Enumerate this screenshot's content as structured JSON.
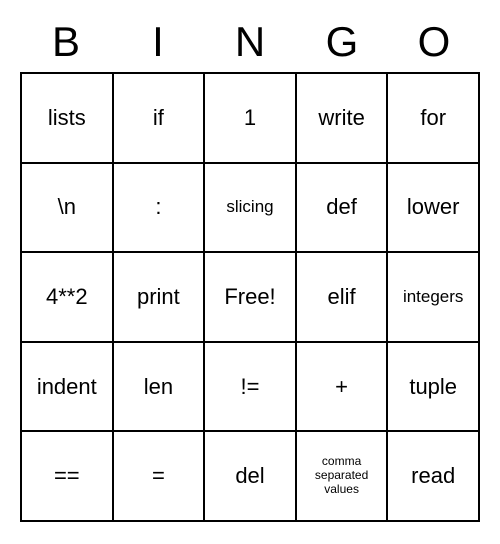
{
  "header": [
    "B",
    "I",
    "N",
    "G",
    "O"
  ],
  "cells": [
    {
      "text": "lists",
      "size": "normal"
    },
    {
      "text": "if",
      "size": "normal"
    },
    {
      "text": "1",
      "size": "normal"
    },
    {
      "text": "write",
      "size": "normal"
    },
    {
      "text": "for",
      "size": "normal"
    },
    {
      "text": "\\n",
      "size": "normal"
    },
    {
      "text": ":",
      "size": "normal"
    },
    {
      "text": "slicing",
      "size": "small"
    },
    {
      "text": "def",
      "size": "normal"
    },
    {
      "text": "lower",
      "size": "normal"
    },
    {
      "text": "4**2",
      "size": "normal"
    },
    {
      "text": "print",
      "size": "normal"
    },
    {
      "text": "Free!",
      "size": "normal"
    },
    {
      "text": "elif",
      "size": "normal"
    },
    {
      "text": "integers",
      "size": "small"
    },
    {
      "text": "indent",
      "size": "normal"
    },
    {
      "text": "len",
      "size": "normal"
    },
    {
      "text": "!=",
      "size": "normal"
    },
    {
      "text": "+",
      "size": "normal"
    },
    {
      "text": "tuple",
      "size": "normal"
    },
    {
      "text": "==",
      "size": "normal"
    },
    {
      "text": "=",
      "size": "normal"
    },
    {
      "text": "del",
      "size": "normal"
    },
    {
      "text": "comma separated values",
      "size": "xsmall"
    },
    {
      "text": "read",
      "size": "normal"
    }
  ]
}
